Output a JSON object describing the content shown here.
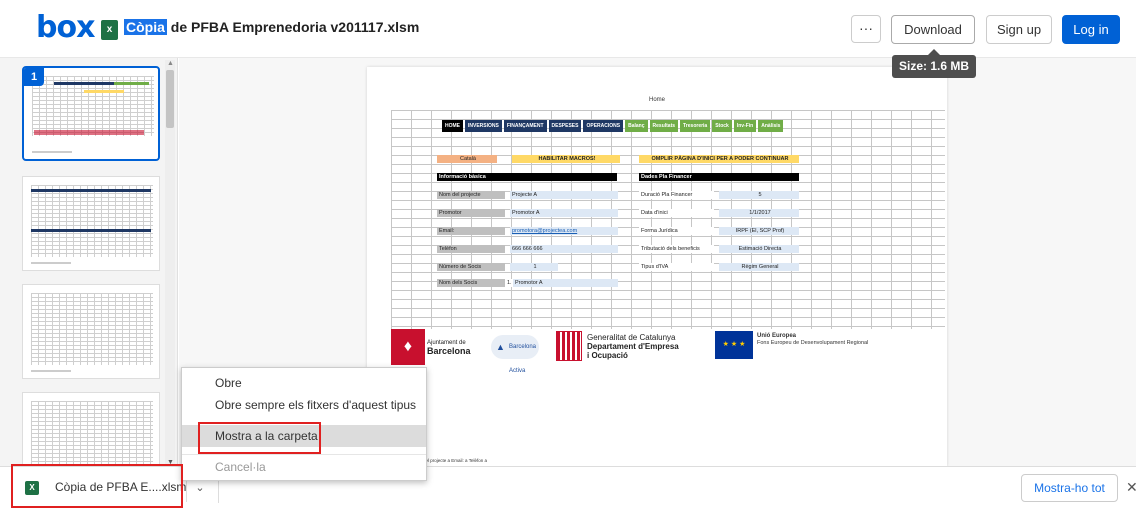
{
  "header": {
    "logo": "box",
    "file_icon": "x",
    "file_title_highlight": "Còpia",
    "file_title_rest": " de PFBA Emprenedoria v201117.xlsm",
    "more_label": "···",
    "download_label": "Download",
    "signup_label": "Sign up",
    "login_label": "Log in",
    "tooltip": "Size: 1.6 MB"
  },
  "sidebar": {
    "active_page": "1"
  },
  "sheet": {
    "heading": "Home",
    "nav": [
      {
        "label": "HOME",
        "color": "#000000"
      },
      {
        "label": "INVERSIONS",
        "color": "#1f3864"
      },
      {
        "label": "FINANÇAMENT",
        "color": "#1f3864"
      },
      {
        "label": "DESPESES",
        "color": "#1f3864"
      },
      {
        "label": "OPERACIONS",
        "color": "#1f3864"
      },
      {
        "label": "Balanç",
        "color": "#70ad47"
      },
      {
        "label": "Resultats",
        "color": "#70ad47"
      },
      {
        "label": "Tresoreria",
        "color": "#70ad47"
      },
      {
        "label": "Stock",
        "color": "#70ad47"
      },
      {
        "label": "Inv-Fin",
        "color": "#70ad47"
      },
      {
        "label": "Anàlisis",
        "color": "#70ad47"
      }
    ],
    "lang": "Català",
    "macros": "HABILITAR MACROS!",
    "fill_start": "OMPLIR PÀGINA D'INICI PER A PODER CONTINUAR",
    "basic_info": "Informació bàsica",
    "plan_data": "Dades Pla Financer",
    "project_label": "Nom del projecte",
    "project_value": "Projecte A",
    "duration_label": "Duració Pla Financer",
    "duration_value": "5",
    "promoter_label": "Promotor",
    "promoter_value": "Promotor A",
    "start_label": "Data d'inici",
    "start_value": "1/1/2017",
    "email_label": "Email:",
    "email_value": "promotora@projectea.com",
    "legal_label": "Forma Jurídica",
    "legal_value": "IRPF (El, SCP Prof)",
    "phone_label": "Telèfon",
    "phone_value": "666 666 666",
    "tax_label": "Tributació dels beneficis",
    "tax_value": "Estimació Directa",
    "partners_label": "Número de Socis",
    "partners_value": "1",
    "vat_label": "Tipus d'IVA",
    "vat_value": "Règim General",
    "partner_names_label": "Nom dels Socis",
    "partner_index": "1.",
    "partner_name": "Promotor A",
    "footer_note": "del projecte a Email: a Telèfon a"
  },
  "logos": {
    "bcn_small": "Ajuntament de",
    "bcn_big": "Barcelona",
    "activa_line1": "Barcelona",
    "activa_line2": "Activa",
    "gen_line1": "Generalitat de Catalunya",
    "gen_line2": "Departament d'Empresa",
    "gen_line3": "i Ocupació",
    "eu_title": "Unió Europea",
    "eu_sub": "Fons Europeu de Desenvolupament Regional"
  },
  "context_menu": {
    "items": [
      {
        "label": "Obre"
      },
      {
        "label": "Obre sempre els fitxers d'aquest tipus"
      },
      {
        "label": "Mostra a la carpeta"
      },
      {
        "label": "Cancel·la"
      }
    ]
  },
  "download_bar": {
    "file_name": "Còpia de PFBA E....xlsm",
    "show_all": "Mostra-ho tot",
    "close": "✕"
  }
}
